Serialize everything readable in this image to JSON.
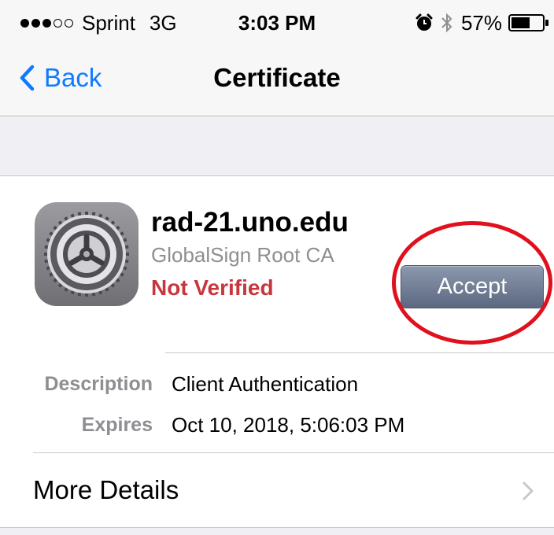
{
  "status_bar": {
    "carrier": "Sprint",
    "network": "3G",
    "time": "3:03 PM",
    "battery_percent": "57%",
    "signal_bars_filled": 3,
    "signal_bars_total": 5,
    "battery_level": 0.57,
    "icons": [
      "alarm-icon",
      "bluetooth-icon",
      "battery-icon"
    ]
  },
  "nav": {
    "back_label": "Back",
    "title": "Certificate",
    "accent_color": "#0e7afe"
  },
  "certificate": {
    "name": "rad-21.uno.edu",
    "issuer": "GlobalSign Root CA",
    "status": "Not Verified",
    "status_color": "#c8363d",
    "icon": "settings-gear-icon",
    "accept_label": "Accept",
    "annotation": "red-circle-highlight-around-accept"
  },
  "details": {
    "description_label": "Description",
    "description_value": "Client Authentication",
    "expires_label": "Expires",
    "expires_value": "Oct 10, 2018, 5:06:03 PM"
  },
  "more_details": {
    "label": "More Details",
    "icon": "chevron-right-icon"
  }
}
